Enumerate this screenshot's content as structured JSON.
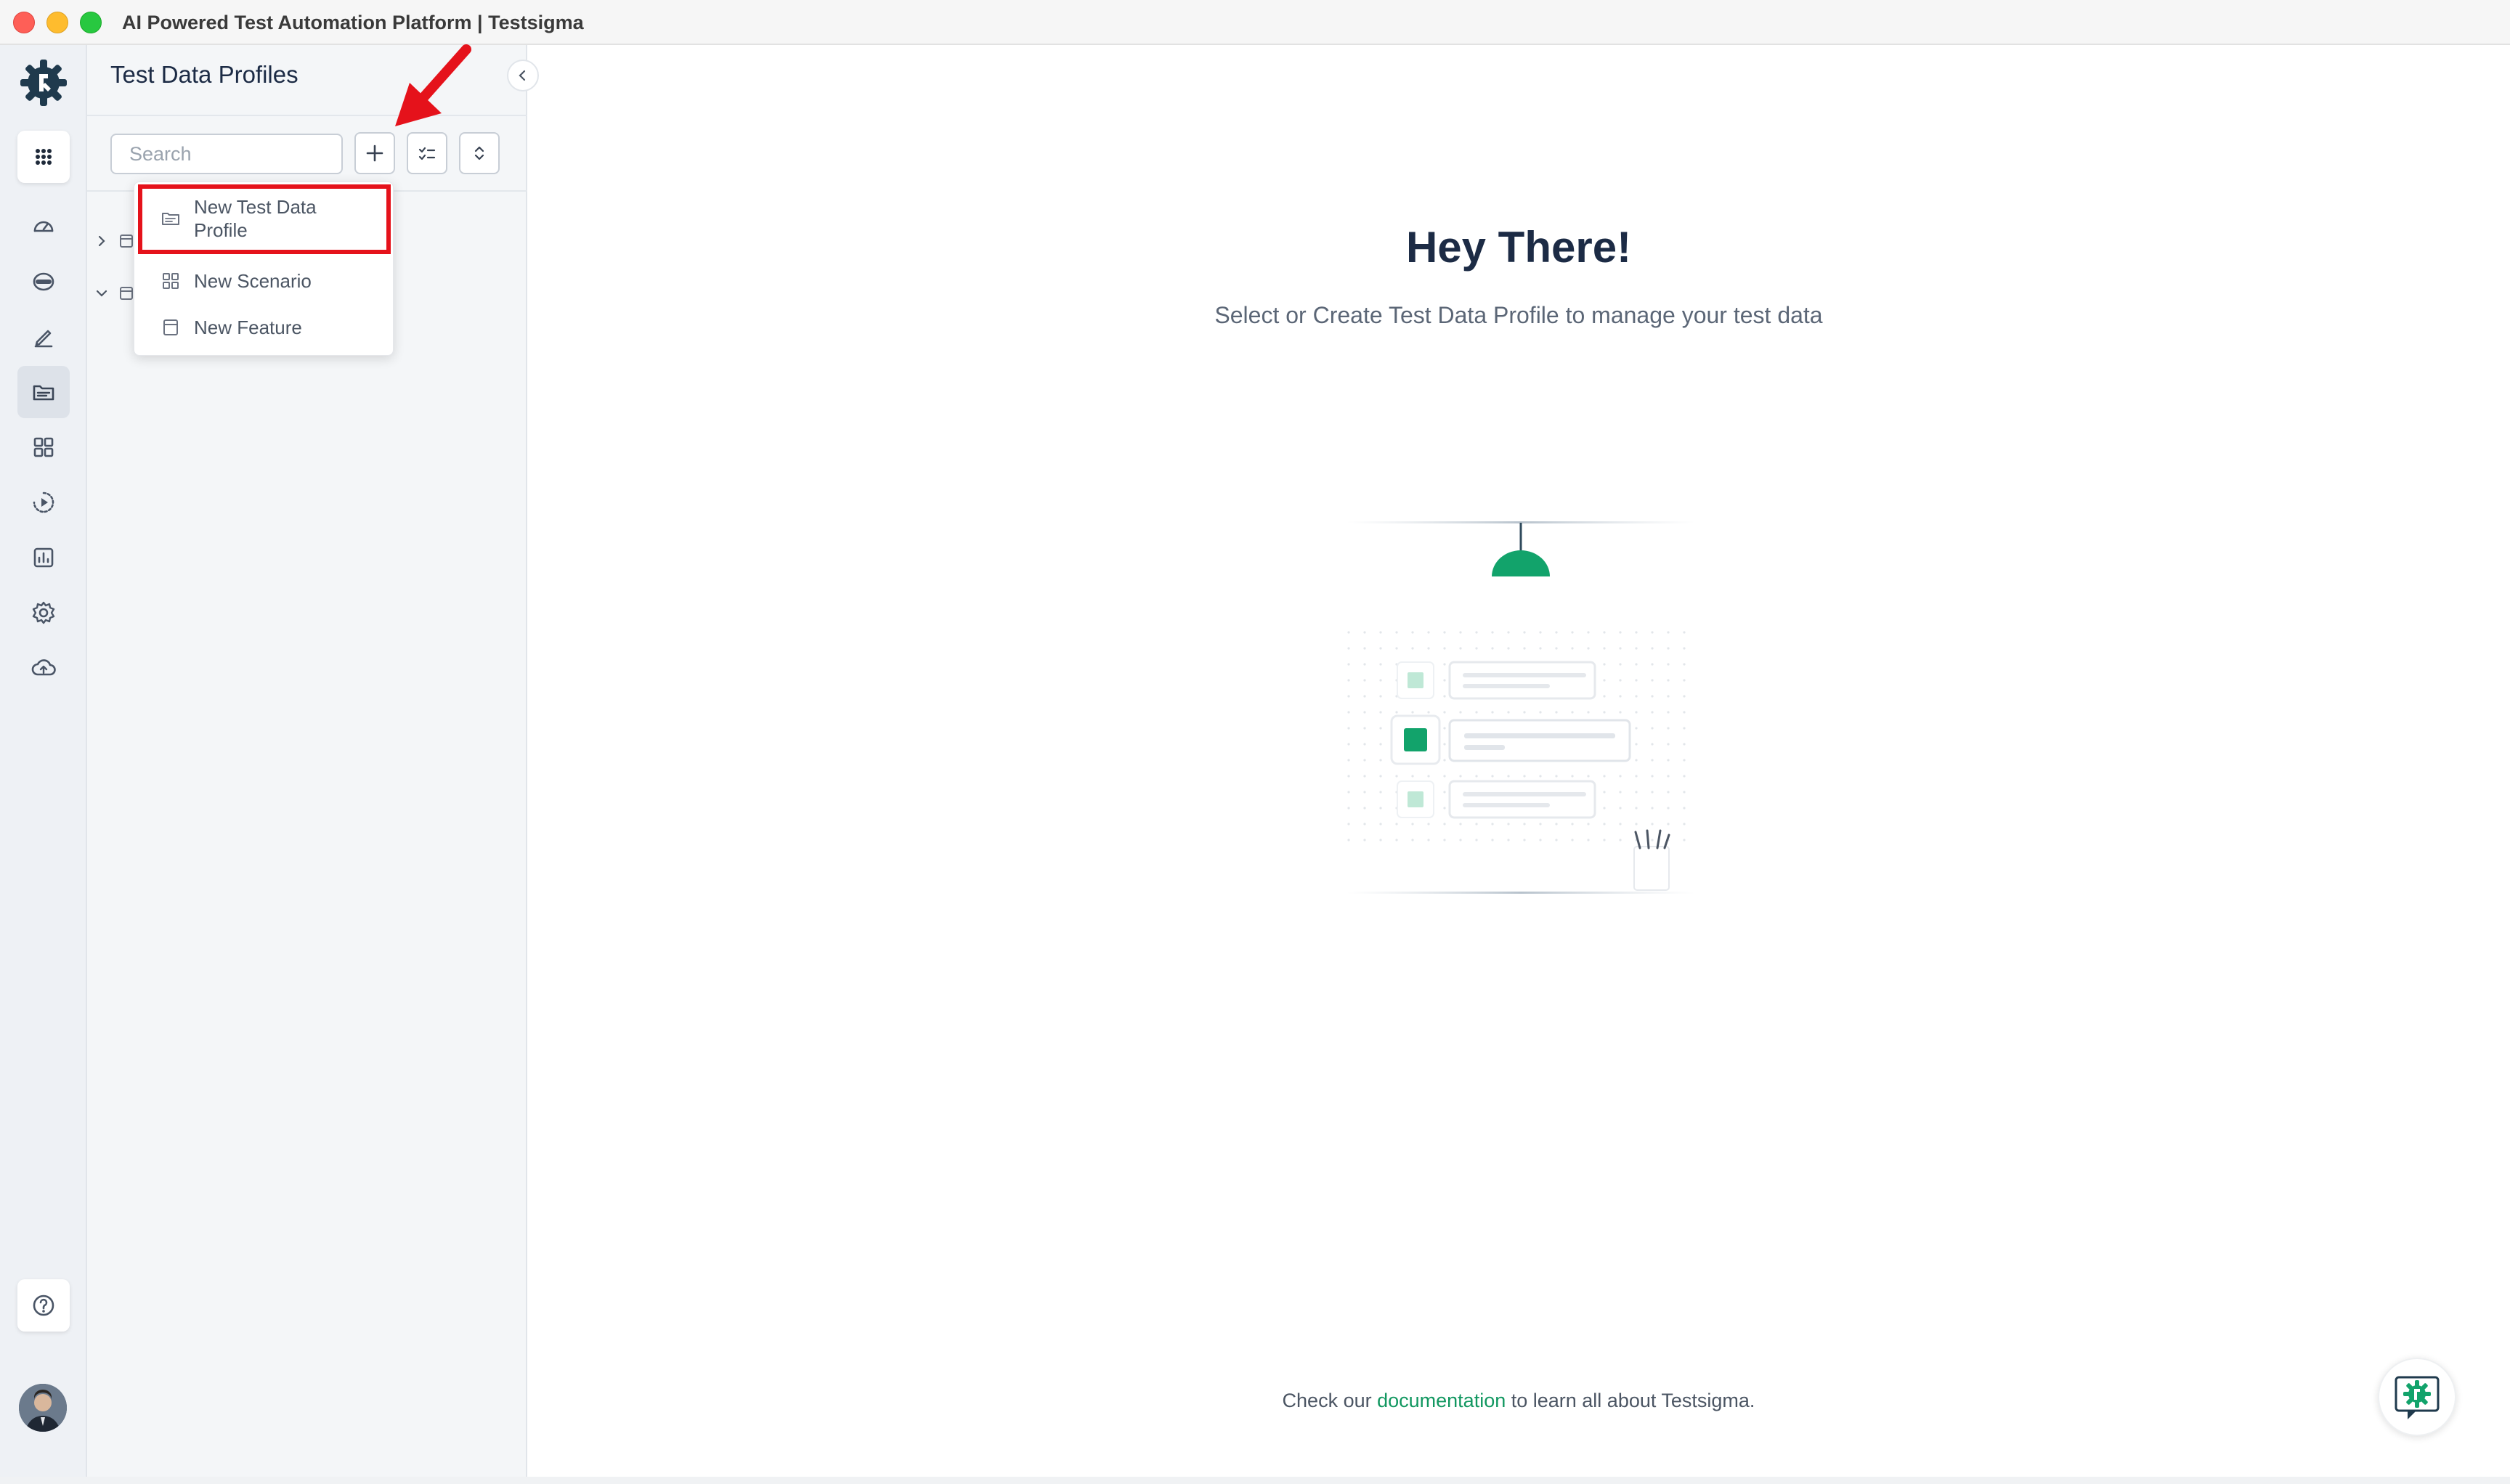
{
  "window": {
    "title": "AI Powered Test Automation Platform | Testsigma"
  },
  "rail": {
    "items": [
      {
        "name": "apps-grid-icon"
      },
      {
        "name": "dashboard-icon"
      },
      {
        "name": "test-development-icon"
      },
      {
        "name": "edit-icon"
      },
      {
        "name": "test-data-icon",
        "active": true
      },
      {
        "name": "components-icon"
      },
      {
        "name": "run-icon"
      },
      {
        "name": "reports-icon"
      },
      {
        "name": "settings-icon"
      },
      {
        "name": "cloud-upload-icon"
      },
      {
        "name": "help-icon"
      }
    ]
  },
  "panel": {
    "title": "Test Data Profiles",
    "search": {
      "placeholder": "Search",
      "value": ""
    }
  },
  "menu": {
    "items": [
      {
        "label": "New Test Data Profile",
        "icon": "folder-icon",
        "highlighted": true
      },
      {
        "label": "New Scenario",
        "icon": "scenario-icon"
      },
      {
        "label": "New Feature",
        "icon": "feature-icon"
      }
    ]
  },
  "main": {
    "title": "Hey There!",
    "subtitle": "Select or Create Test Data Profile to manage your test data",
    "footer_pre": "Check our ",
    "footer_link": "documentation",
    "footer_post": " to learn all about Testsigma."
  },
  "colors": {
    "brand_dark": "#1f3a4d",
    "accent_green": "#12a36b",
    "highlight_red": "#e5121b",
    "title_navy": "#1c2b45"
  }
}
